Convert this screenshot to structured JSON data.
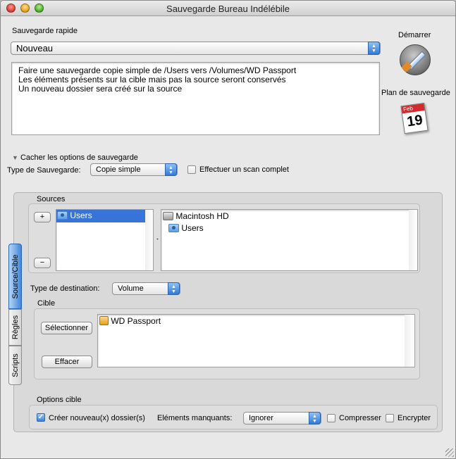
{
  "window": {
    "title": "Sauvegarde Bureau Indélébile"
  },
  "quick_backup": {
    "label": "Sauvegarde rapide",
    "selected": "Nouveau",
    "description": [
      "Faire une sauvegarde copie simple de /Users vers /Volumes/WD Passport",
      "Les éléments présents sur la cible mais pas la source seront conservés",
      "Un nouveau dossier sera créé sur la source"
    ]
  },
  "side": {
    "start_label": "Démarrer",
    "schedule_label": "Plan de sauvegarde",
    "calendar_month": "Feb",
    "calendar_day": "19"
  },
  "options": {
    "toggle_label": "Cacher les options de sauvegarde",
    "type_label": "Type de Sauvegarde:",
    "type_value": "Copie simple",
    "full_scan_label": "Effectuer un scan complet"
  },
  "tabs": [
    "Source/Cible",
    "Règles",
    "Scripts"
  ],
  "sources": {
    "label": "Sources",
    "add_label": "+",
    "remove_label": "−",
    "list": [
      "Users"
    ],
    "tree_root": "Macintosh HD",
    "tree_child": "Users"
  },
  "destination": {
    "type_label": "Type de destination:",
    "type_value": "Volume",
    "target_label": "Cible",
    "select_button": "Sélectionner",
    "clear_button": "Effacer",
    "target_item": "WD Passport"
  },
  "target_options": {
    "label": "Options cible",
    "create_folders_label": "Créer nouveau(x) dossier(s)",
    "create_folders_checked": true,
    "missing_label": "Eléments manquants:",
    "missing_value": "Ignorer",
    "compress_label": "Compresser",
    "encrypt_label": "Encrypter"
  },
  "colors": {
    "accent": "#3a82d8",
    "selection": "#3874d8"
  }
}
